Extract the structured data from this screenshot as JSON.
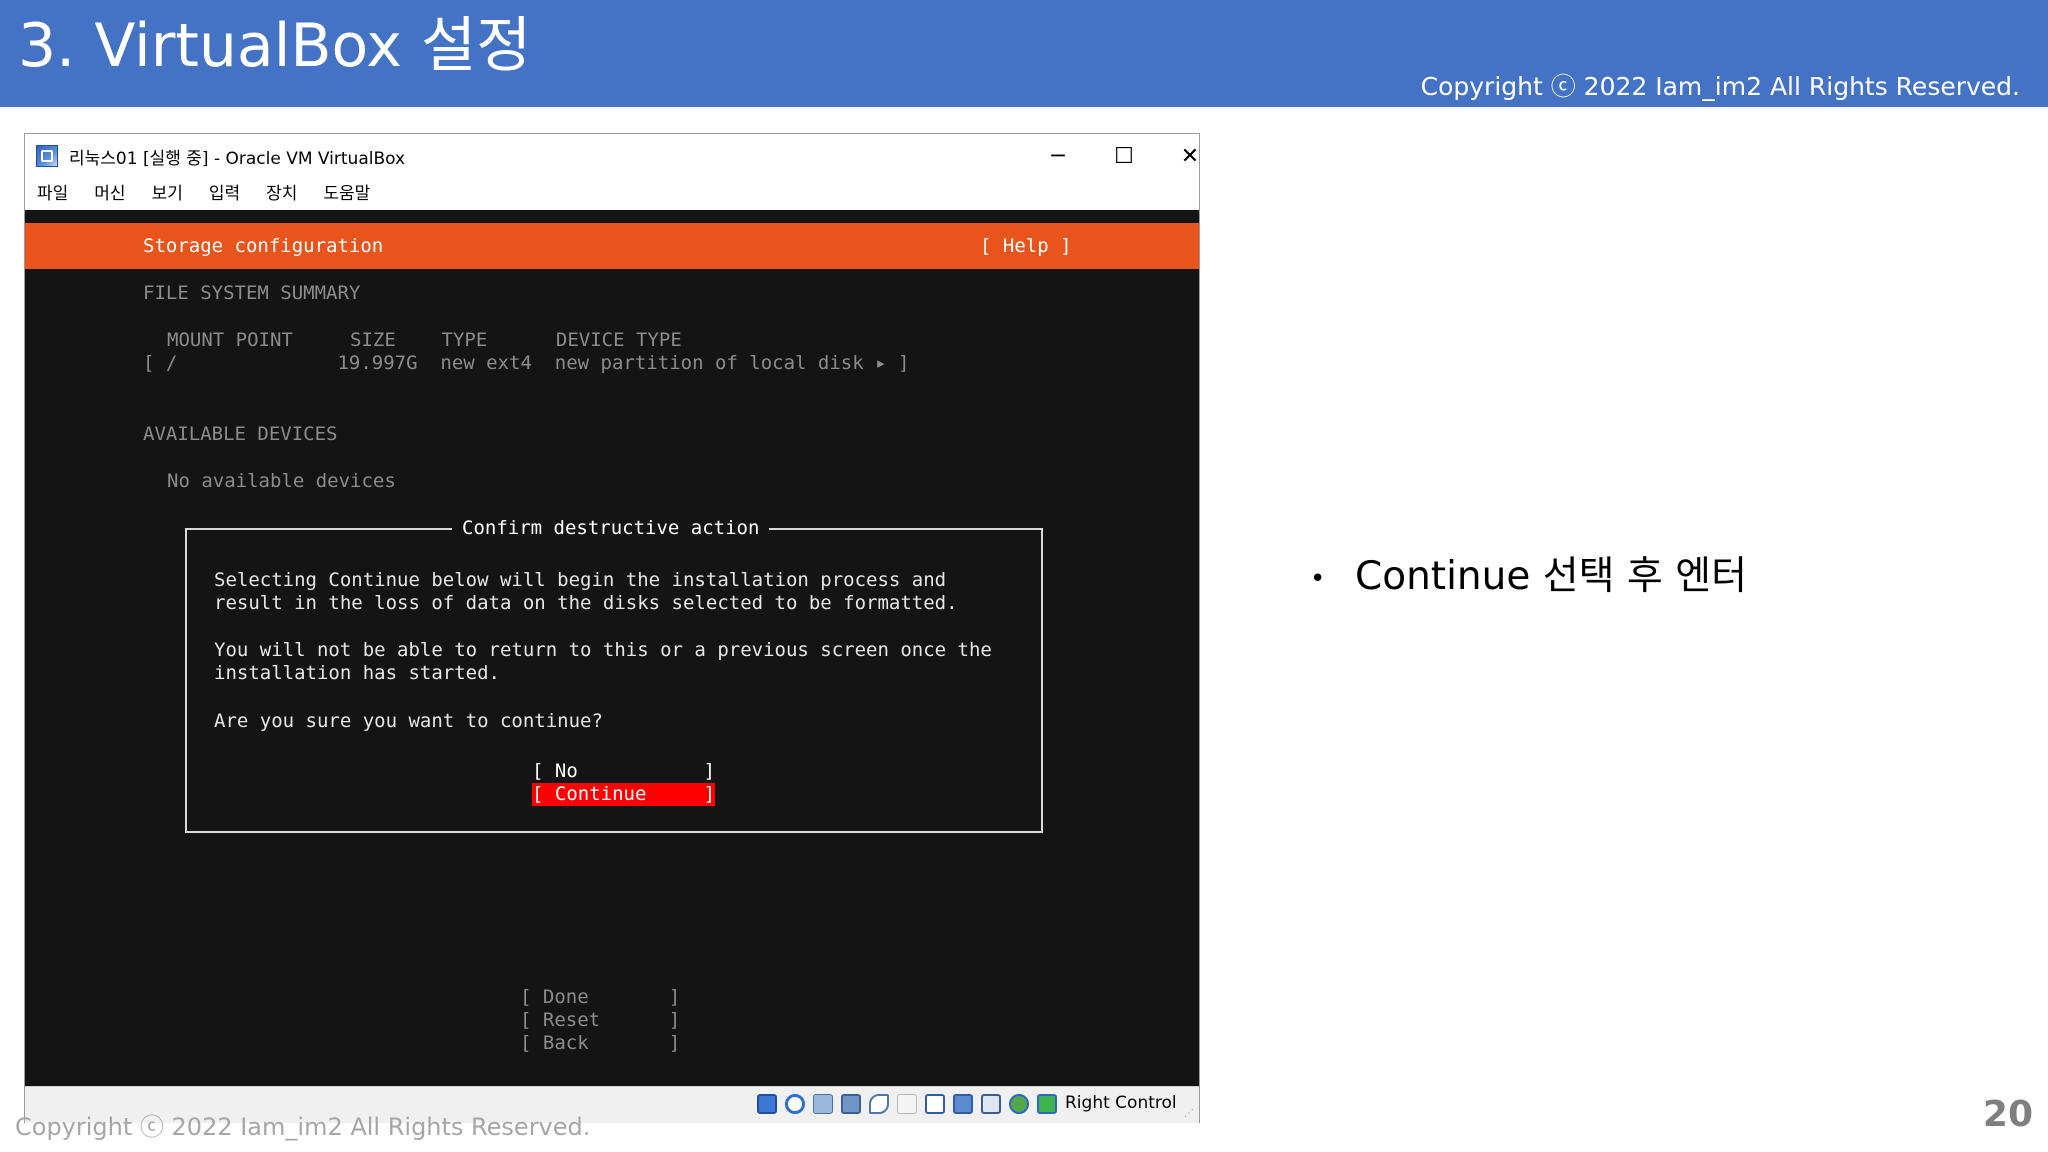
{
  "slide": {
    "title": "3. VirtualBox 설정",
    "copyright_top": "Copyright ⓒ 2022 Iam_im2 All Rights Reserved.",
    "copyright_bottom": "Copyright ⓒ 2022 Iam_im2 All Rights Reserved.",
    "page_number": "20",
    "bullet_text": "Continue 선택 후 엔터",
    "bullet_glyph": "•",
    "header_color": "#4472c4"
  },
  "window": {
    "title": "리눅스01 [실행 중] - Oracle VM VirtualBox",
    "icon": "virtualbox-logo-icon",
    "controls": {
      "minimize": "─",
      "maximize": "☐",
      "close": "✕"
    },
    "menu": [
      "파일",
      "머신",
      "보기",
      "입력",
      "장치",
      "도움말"
    ]
  },
  "installer": {
    "accent_color": "#e9541c",
    "header_title": "Storage configuration",
    "help_label": "[ Help ]",
    "fs_summary_heading": "FILE SYSTEM SUMMARY",
    "fs_columns": "MOUNT POINT     SIZE    TYPE      DEVICE TYPE",
    "fs_row": "[ /              19.997G  new ext4  new partition of local disk ▸ ]",
    "available_heading": "AVAILABLE DEVICES",
    "available_empty": "No available devices",
    "dialog": {
      "title": "Confirm destructive action",
      "line1": "Selecting Continue below will begin the installation process and",
      "line2": "result in the loss of data on the disks selected to be formatted.",
      "line3": "You will not be able to return to this or a previous screen once the",
      "line4": "installation has started.",
      "line5": "Are you sure you want to continue?",
      "no_label": "[ No           ]",
      "continue_label": "[ Continue     ]",
      "selected_color": "#ff0000"
    },
    "bottom_buttons": [
      "[ Done       ]",
      "[ Reset      ]",
      "[ Back       ]"
    ]
  },
  "status_bar": {
    "icons": [
      "hard-disk-icon",
      "optical-drive-icon",
      "audio-icon",
      "network-icon",
      "usb-icon",
      "shared-folders-icon",
      "display-icon",
      "video-capture-icon",
      "vt-x-icon",
      "mouse-integration-icon",
      "keyboard-icon"
    ],
    "host_key": "Right Control"
  }
}
